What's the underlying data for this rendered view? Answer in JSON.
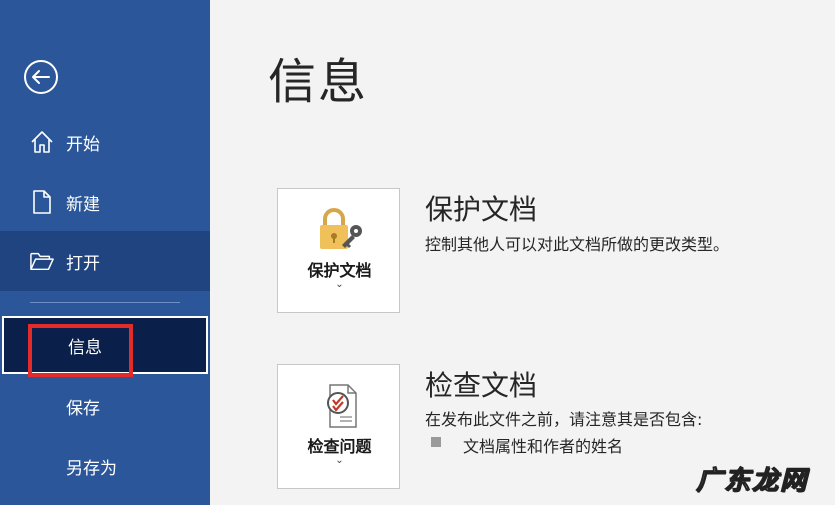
{
  "sidebar": {
    "back_label": "",
    "items": [
      {
        "key": "home",
        "label": "开始",
        "icon": "home-icon"
      },
      {
        "key": "new",
        "label": "新建",
        "icon": "document-icon"
      },
      {
        "key": "open",
        "label": "打开",
        "icon": "folder-open-icon"
      },
      {
        "key": "info",
        "label": "信息"
      },
      {
        "key": "save",
        "label": "保存"
      },
      {
        "key": "saveas",
        "label": "另存为"
      }
    ]
  },
  "main": {
    "title": "信息",
    "protect": {
      "button_label": "保护文档",
      "heading": "保护文档",
      "description": "控制其他人可以对此文档所做的更改类型。"
    },
    "inspect": {
      "button_label": "检查问题",
      "heading": "检查文档",
      "description": "在发布此文件之前，请注意其是否包含:",
      "bullets": [
        "文档属性和作者的姓名"
      ]
    }
  },
  "watermark": "广东龙网",
  "colors": {
    "sidebar_bg": "#2b579a",
    "sidebar_selected": "#0a1f4a",
    "highlight": "#e22c2c",
    "main_bg": "#f3f3f3"
  }
}
